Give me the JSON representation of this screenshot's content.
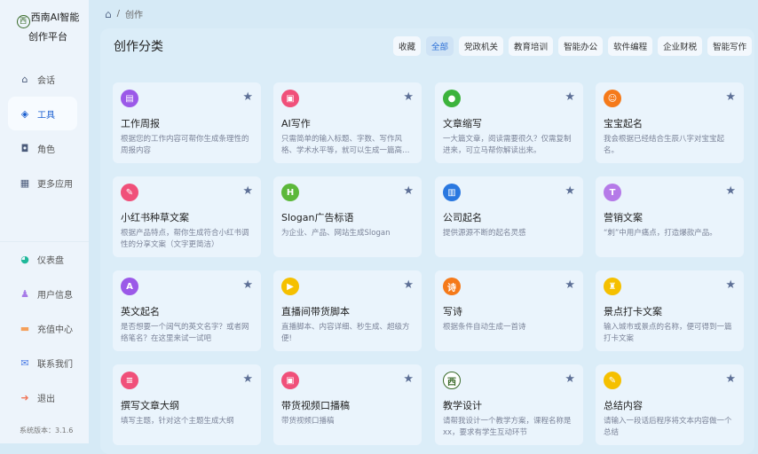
{
  "app": {
    "title_line1": "西南AI智能",
    "title_line2": "创作平台",
    "logo_text": "西",
    "version": "系统版本：3.1.6"
  },
  "nav_top": [
    {
      "label": "会话",
      "icon": "home-icon",
      "color": "#4a5a7a"
    },
    {
      "label": "工具",
      "icon": "tools-icon",
      "color": "#1a5fd0",
      "active": true
    },
    {
      "label": "角色",
      "icon": "role-icon",
      "color": "#4a5a7a"
    },
    {
      "label": "更多应用",
      "icon": "grid-icon",
      "color": "#4a5a7a"
    }
  ],
  "nav_bottom": [
    {
      "label": "仪表盘",
      "icon": "dashboard-icon",
      "color": "#1fb89a"
    },
    {
      "label": "用户信息",
      "icon": "user-icon",
      "color": "#a77be8"
    },
    {
      "label": "充值中心",
      "icon": "wallet-icon",
      "color": "#f5a05a"
    },
    {
      "label": "联系我们",
      "icon": "mail-icon",
      "color": "#4c7ce6"
    },
    {
      "label": "退出",
      "icon": "logout-icon",
      "color": "#f0775a"
    }
  ],
  "breadcrumb": {
    "current": "创作",
    "separator": "/"
  },
  "page_title": "创作分类",
  "tabs": [
    {
      "label": "收藏"
    },
    {
      "label": "全部",
      "active": true
    },
    {
      "label": "党政机关"
    },
    {
      "label": "教育培训"
    },
    {
      "label": "智能办公"
    },
    {
      "label": "软件编程"
    },
    {
      "label": "企业财税"
    },
    {
      "label": "智能写作"
    }
  ],
  "cards": [
    {
      "name": "工作周报",
      "desc": "根据您的工作内容可帮你生成条理性的周报内容",
      "color": "#9b59e8",
      "glyph": "▤"
    },
    {
      "name": "AI写作",
      "desc": "只需简单的输入标题、字数、写作风格、学术水平等，就可以生成一篇高质量的文章",
      "color": "#f0507a",
      "glyph": "▣"
    },
    {
      "name": "文章缩写",
      "desc": "一大篇文章，阅读需要很久？仅需复制进来，可立马帮你解读出来。",
      "color": "#3cb33c",
      "glyph": "●"
    },
    {
      "name": "宝宝起名",
      "desc": "我会根据已经结合生辰八字对宝宝起名。",
      "color": "#f57a1a",
      "glyph": "☺"
    },
    {
      "name": "小红书种草文案",
      "desc": "根据产品特点，帮你生成符合小红书调性的分享文案（文字更简洁）",
      "color": "#f0507a",
      "glyph": "✎"
    },
    {
      "name": "Slogan广告标语",
      "desc": "为企业、产品、网站生成Slogan",
      "color": "#5cb83a",
      "glyph": "H"
    },
    {
      "name": "公司起名",
      "desc": "提供源源不断的起名灵感",
      "color": "#2a78e0",
      "glyph": "▥"
    },
    {
      "name": "营销文案",
      "desc": "“刺”中用户痛点，打造爆款产品。",
      "color": "#b57ae8",
      "glyph": "T"
    },
    {
      "name": "英文起名",
      "desc": "是否想要一个阔气的英文名字？或者网络笔名？在这里来试一试吧",
      "color": "#9b59e8",
      "glyph": "A"
    },
    {
      "name": "直播间带货脚本",
      "desc": "直播脚本、内容详细、秒生成、超级方便!",
      "color": "#f5c000",
      "glyph": "▶"
    },
    {
      "name": "写诗",
      "desc": "根据条件自动生成一首诗",
      "color": "#f57a1a",
      "glyph": "诗"
    },
    {
      "name": "景点打卡文案",
      "desc": "输入城市或景点的名称，便可得到一篇打卡文案",
      "color": "#f5c000",
      "glyph": "♜"
    },
    {
      "name": "撰写文章大纲",
      "desc": "填写主题，针对这个主题生成大纲",
      "color": "#f0507a",
      "glyph": "≡"
    },
    {
      "name": "带货视频口播稿",
      "desc": "带货视频口播稿",
      "color": "#f0507a",
      "glyph": "▣"
    },
    {
      "name": "教学设计",
      "desc": "请帮我设计一个教学方案，课程名称是xx，要求有学生互动环节",
      "color": "#ffffff",
      "glyph": "西"
    },
    {
      "name": "总结内容",
      "desc": "请输入一段话后程序将文本内容做一个总结",
      "color": "#f5c000",
      "glyph": "✎"
    }
  ]
}
